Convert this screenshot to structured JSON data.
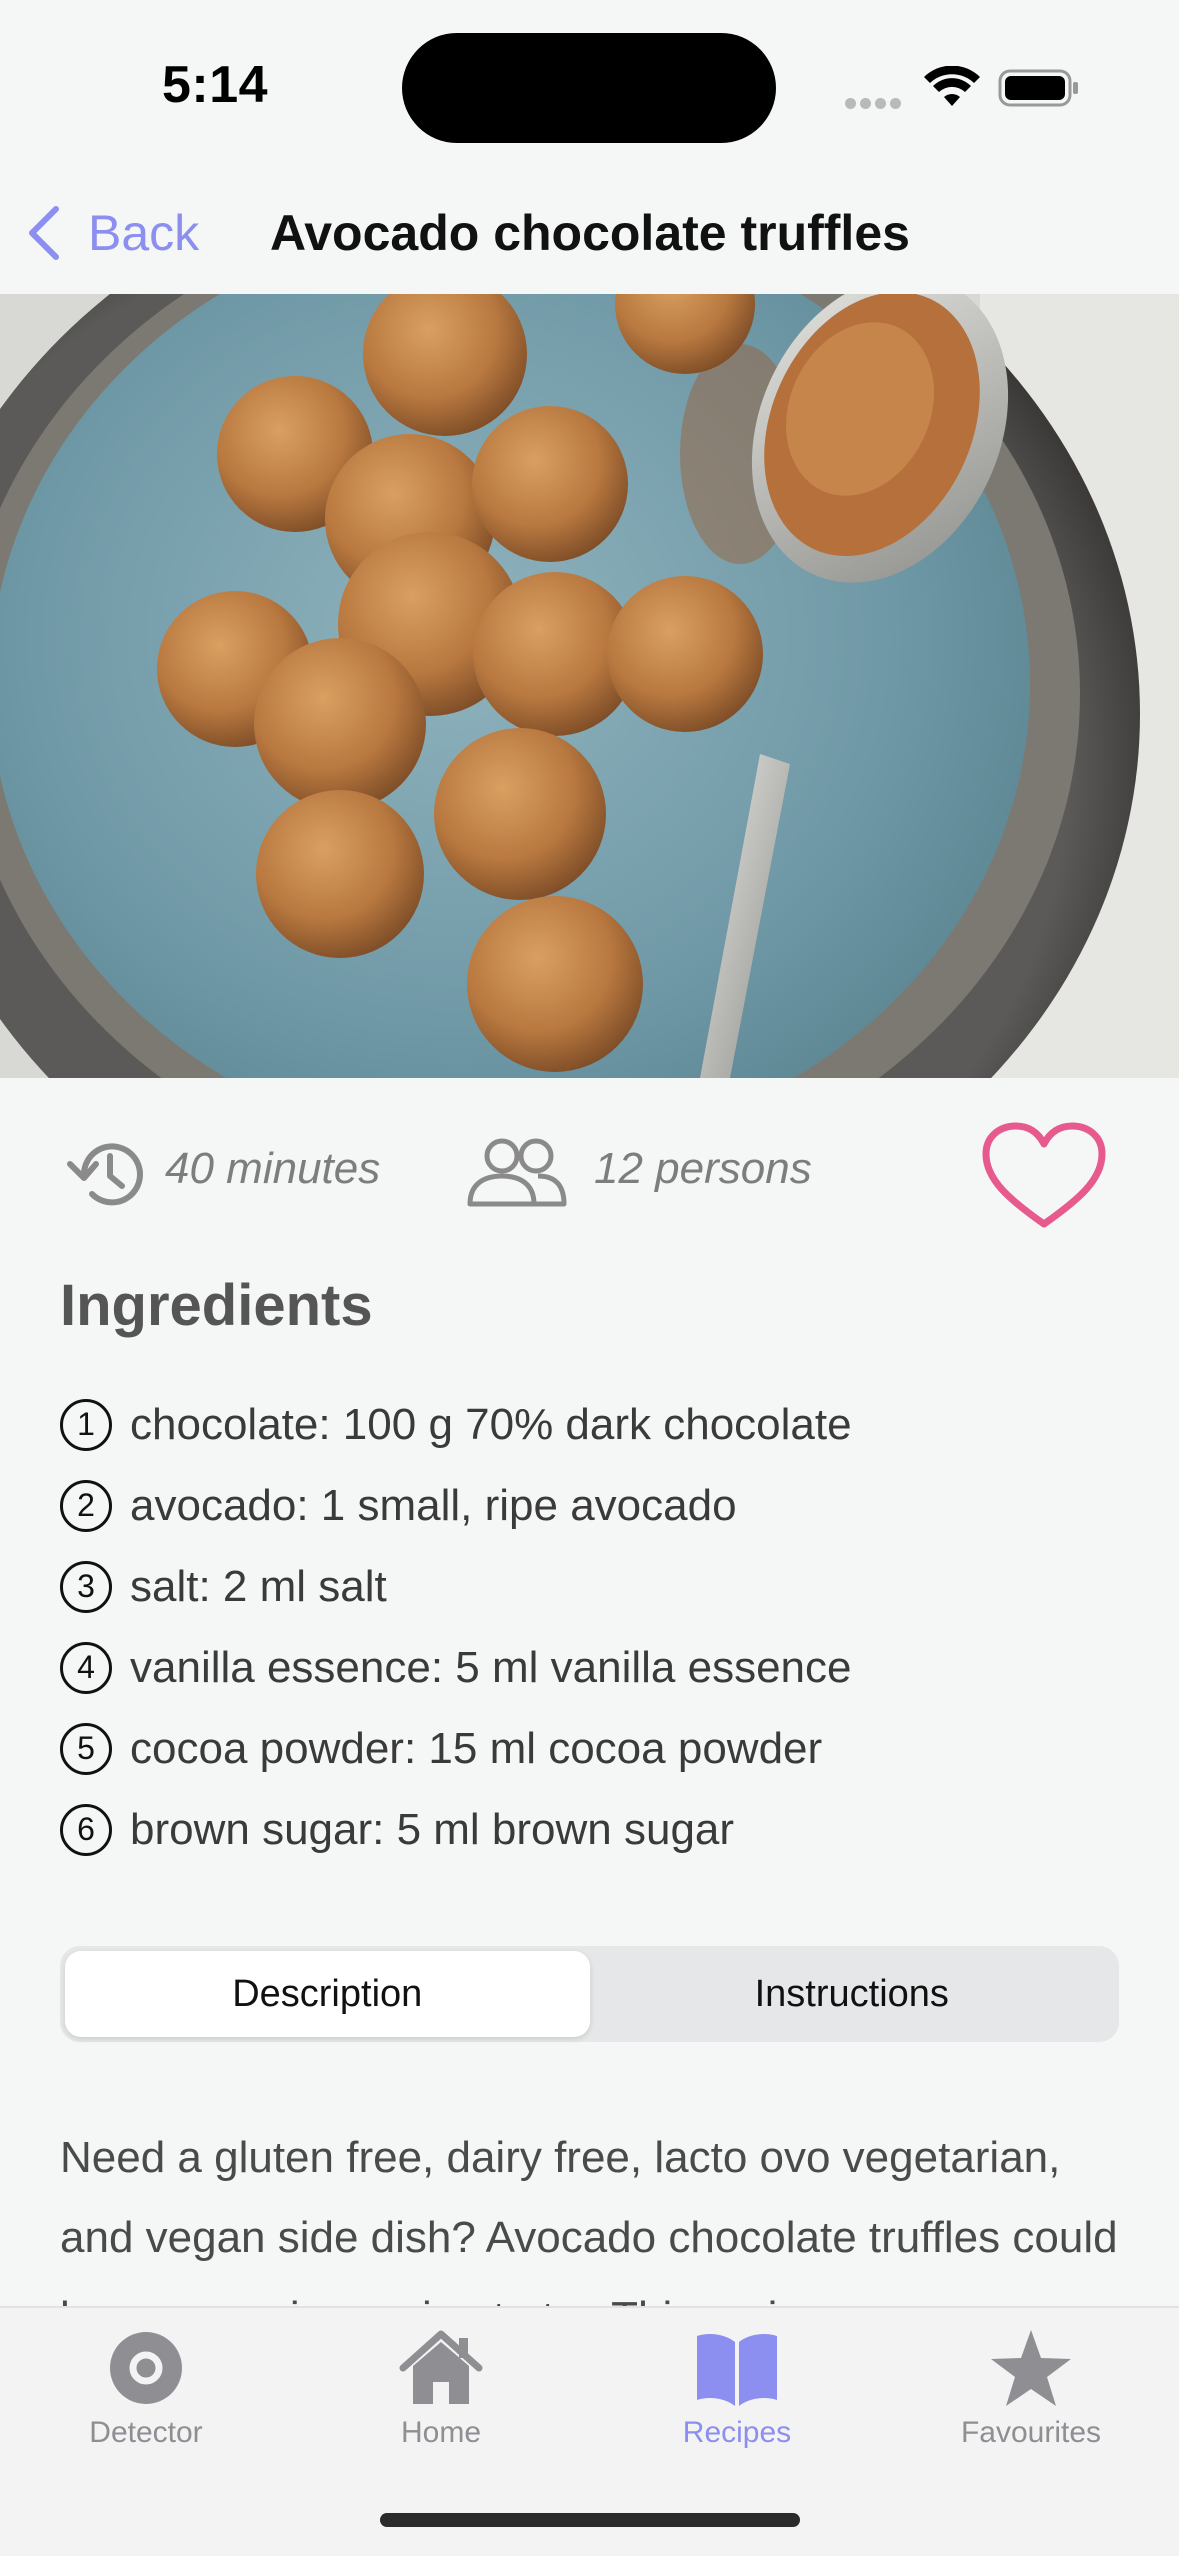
{
  "status_bar": {
    "time": "5:14",
    "icons": [
      "cellular-dots-icon",
      "wifi-icon",
      "battery-icon"
    ]
  },
  "nav": {
    "back_label": "Back",
    "title": "Avocado chocolate truffles",
    "accent_color": "#8c8ff0"
  },
  "hero": {
    "subject": "chocolate truffles on blue plate with spoon of cocoa powder"
  },
  "meta": {
    "time_icon": "clock-history-icon",
    "time_text": "40 minutes",
    "people_icon": "people-icon",
    "servings_text": "12 persons",
    "favourite_icon": "heart-icon",
    "favourite_color": "#e75a8d"
  },
  "ingredients": {
    "title": "Ingredients",
    "items": [
      {
        "number": "1",
        "text": "chocolate: 100 g 70% dark chocolate"
      },
      {
        "number": "2",
        "text": "avocado: 1 small, ripe avocado"
      },
      {
        "number": "3",
        "text": "salt: 2 ml salt"
      },
      {
        "number": "4",
        "text": "vanilla essence: 5 ml vanilla essence"
      },
      {
        "number": "5",
        "text": "cocoa powder: 15 ml cocoa powder"
      },
      {
        "number": "6",
        "text": "brown sugar: 5 ml brown sugar"
      }
    ]
  },
  "tabs_segment": {
    "description_label": "Description",
    "instructions_label": "Instructions",
    "selected": "Description"
  },
  "description": {
    "text": "Need a gluten free, dairy free, lacto ovo vegetarian, and vegan side dish? Avocado chocolate truffles could be an amazing recipe to try. This recipe"
  },
  "tab_bar": {
    "items": [
      {
        "label": "Detector",
        "icon": "detector-icon"
      },
      {
        "label": "Home",
        "icon": "house-icon"
      },
      {
        "label": "Recipes",
        "icon": "book-icon"
      },
      {
        "label": "Favourites",
        "icon": "star-icon"
      }
    ],
    "active": "Recipes"
  }
}
